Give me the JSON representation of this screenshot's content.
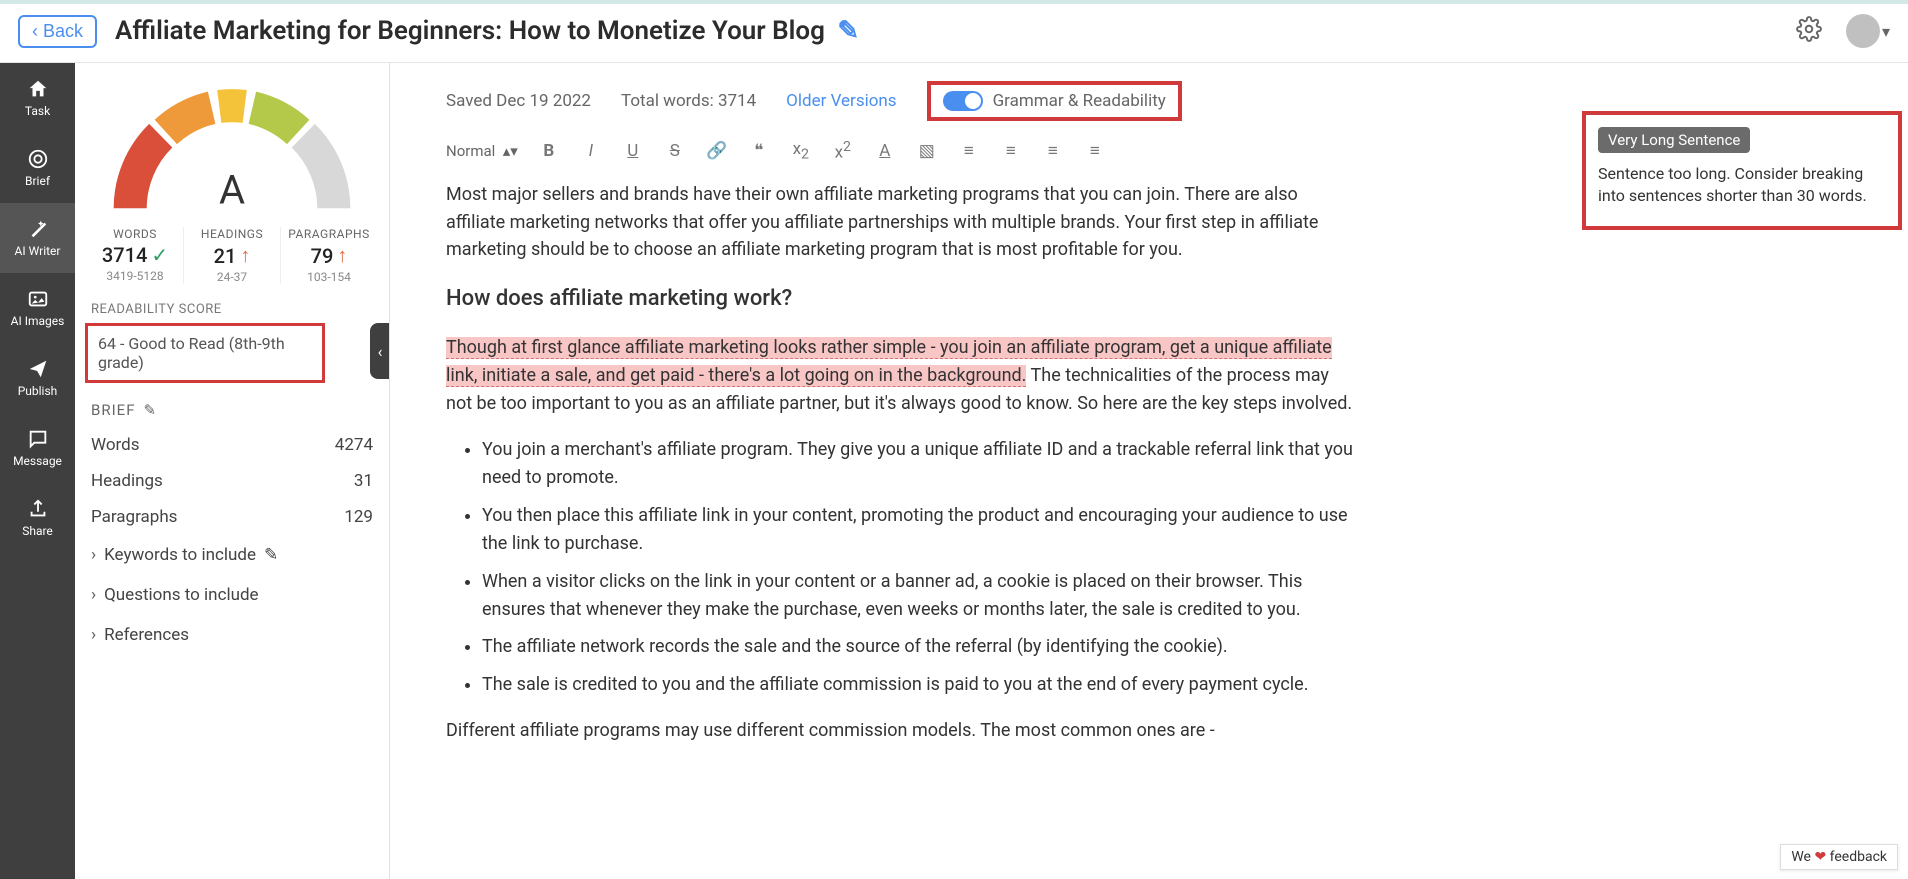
{
  "header": {
    "back": "Back",
    "title": "Affiliate Marketing for Beginners: How to Monetize Your Blog"
  },
  "nav": {
    "task": "Task",
    "brief": "Brief",
    "aiwriter": "AI Writer",
    "aiimages": "AI Images",
    "publish": "Publish",
    "message": "Message",
    "share": "Share"
  },
  "gauge": {
    "grade": "A"
  },
  "stats": {
    "words": {
      "label": "WORDS",
      "value": "3714",
      "range": "3419-5128"
    },
    "headings": {
      "label": "HEADINGS",
      "value": "21",
      "range": "24-37"
    },
    "paragraphs": {
      "label": "PARAGRAPHS",
      "value": "79",
      "range": "103-154"
    }
  },
  "readability": {
    "label": "READABILITY SCORE",
    "value": "64 - Good to Read (8th-9th grade)"
  },
  "brief": {
    "label": "BRIEF",
    "words": {
      "label": "Words",
      "value": "4274"
    },
    "headings": {
      "label": "Headings",
      "value": "31"
    },
    "paragraphs": {
      "label": "Paragraphs",
      "value": "129"
    },
    "keywords": "Keywords to include",
    "questions": "Questions to include",
    "references": "References"
  },
  "docbar": {
    "saved": "Saved Dec 19 2022",
    "total": "Total words: 3714",
    "older": "Older Versions",
    "grammar": "Grammar & Readability"
  },
  "toolbar": {
    "normal": "Normal"
  },
  "tooltip": {
    "title": "Very Long Sentence",
    "body": "Sentence too long. Consider breaking into sentences shorter than 30 words."
  },
  "content": {
    "p1": "Most major sellers and brands have their own affiliate marketing programs that you can join. There are also affiliate marketing networks that offer you affiliate partnerships with multiple brands. Your first step in affiliate marketing should be to choose an affiliate marketing program that is most profitable for you.",
    "h1": "How does affiliate marketing work?",
    "p2_hl": "Though at first glance affiliate marketing looks rather simple - you join an affiliate program, get a unique affiliate link, initiate a sale, and get paid - there's a lot going on in the background.",
    "p2_rest": " The technicalities of the process may not be too important to you as an affiliate partner, but it's always good to know. So here are the key steps involved.",
    "li1": "You join a merchant's affiliate program. They give you a unique affiliate ID and a trackable referral link that you need to promote.",
    "li2": "You then place this affiliate link in your content, promoting the product and encouraging your audience to use the link to purchase.",
    "li3": "When a visitor clicks on the link in your content or a banner ad, a cookie is placed on their browser. This ensures that whenever they make the purchase, even weeks or months later, the sale is credited to you.",
    "li4": "The affiliate network records the sale and the source of the referral (by identifying the cookie).",
    "li5": "The sale is credited to you and the affiliate commission is paid to you at the end of every payment cycle.",
    "p3": "Different affiliate programs may use different commission models. The most common ones are -"
  },
  "feedback": {
    "pre": "We ",
    "post": " feedback"
  }
}
